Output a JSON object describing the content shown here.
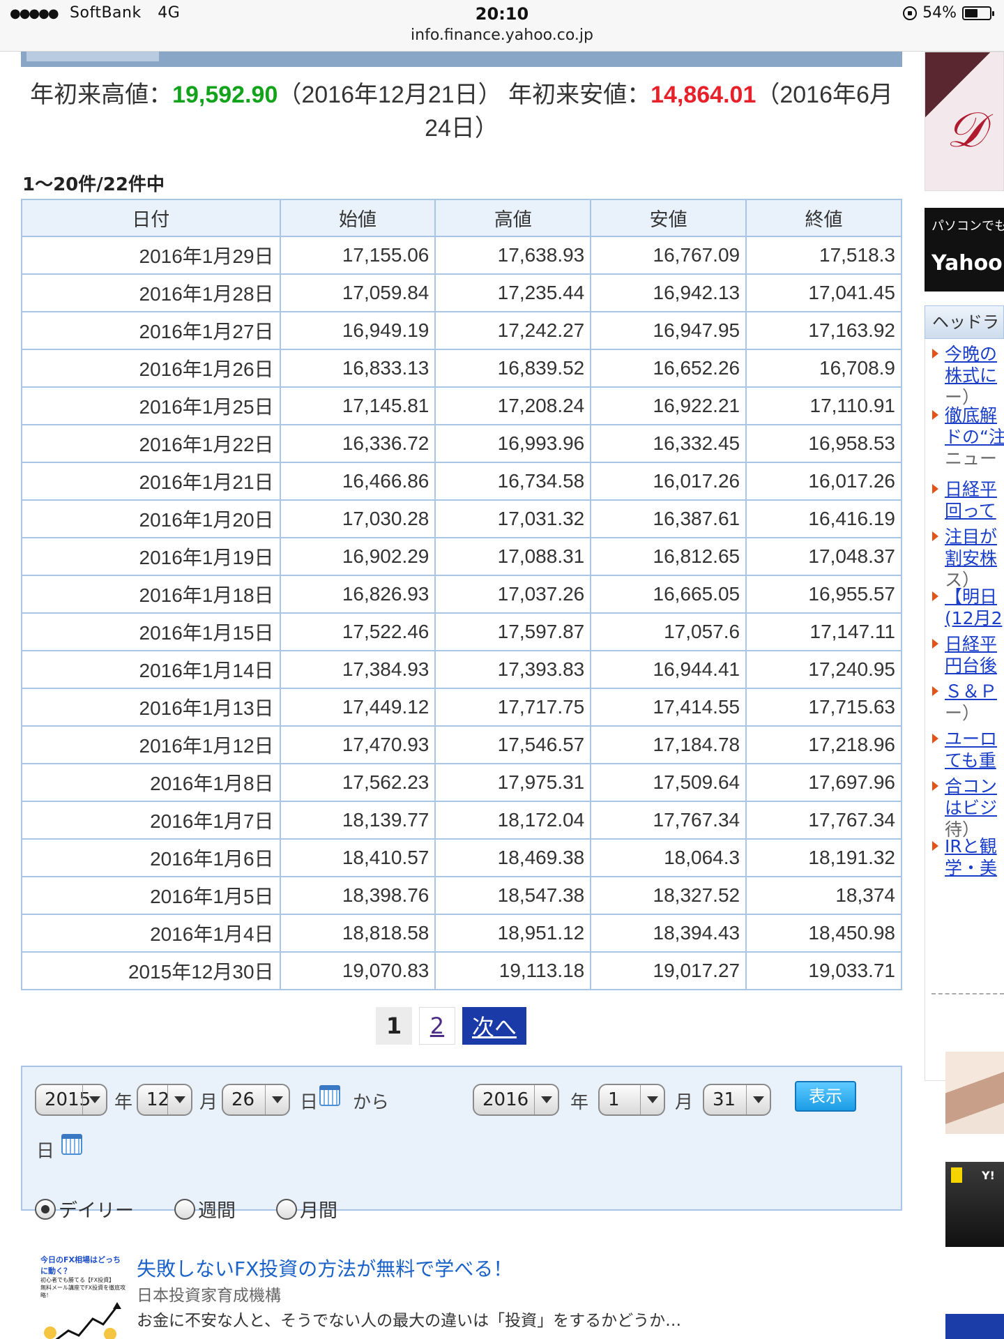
{
  "status_bar": {
    "signal": "●●●●●",
    "carrier": "SoftBank",
    "network": "4G",
    "time": "20:10",
    "battery": "54%"
  },
  "url": "info.finance.yahoo.co.jp",
  "year_range": {
    "high_label": "年初来高値：",
    "high_value": "19,592.90",
    "high_date": "（2016年12月21日）",
    "low_label": "年初来安値：",
    "low_value": "14,864.01",
    "low_date": "（2016年6月24日）"
  },
  "result_count": "1〜20件/22件中",
  "table": {
    "headers": [
      "日付",
      "始値",
      "高値",
      "安値",
      "終値"
    ],
    "rows": [
      [
        "2016年1月29日",
        "17,155.06",
        "17,638.93",
        "16,767.09",
        "17,518.3"
      ],
      [
        "2016年1月28日",
        "17,059.84",
        "17,235.44",
        "16,942.13",
        "17,041.45"
      ],
      [
        "2016年1月27日",
        "16,949.19",
        "17,242.27",
        "16,947.95",
        "17,163.92"
      ],
      [
        "2016年1月26日",
        "16,833.13",
        "16,839.52",
        "16,652.26",
        "16,708.9"
      ],
      [
        "2016年1月25日",
        "17,145.81",
        "17,208.24",
        "16,922.21",
        "17,110.91"
      ],
      [
        "2016年1月22日",
        "16,336.72",
        "16,993.96",
        "16,332.45",
        "16,958.53"
      ],
      [
        "2016年1月21日",
        "16,466.86",
        "16,734.58",
        "16,017.26",
        "16,017.26"
      ],
      [
        "2016年1月20日",
        "17,030.28",
        "17,031.32",
        "16,387.61",
        "16,416.19"
      ],
      [
        "2016年1月19日",
        "16,902.29",
        "17,088.31",
        "16,812.65",
        "17,048.37"
      ],
      [
        "2016年1月18日",
        "16,826.93",
        "17,037.26",
        "16,665.05",
        "16,955.57"
      ],
      [
        "2016年1月15日",
        "17,522.46",
        "17,597.87",
        "17,057.6",
        "17,147.11"
      ],
      [
        "2016年1月14日",
        "17,384.93",
        "17,393.83",
        "16,944.41",
        "17,240.95"
      ],
      [
        "2016年1月13日",
        "17,449.12",
        "17,717.75",
        "17,414.55",
        "17,715.63"
      ],
      [
        "2016年1月12日",
        "17,470.93",
        "17,546.57",
        "17,184.78",
        "17,218.96"
      ],
      [
        "2016年1月8日",
        "17,562.23",
        "17,975.31",
        "17,509.64",
        "17,697.96"
      ],
      [
        "2016年1月7日",
        "18,139.77",
        "18,172.04",
        "17,767.34",
        "17,767.34"
      ],
      [
        "2016年1月6日",
        "18,410.57",
        "18,469.38",
        "18,064.3",
        "18,191.32"
      ],
      [
        "2016年1月5日",
        "18,398.76",
        "18,547.38",
        "18,327.52",
        "18,374"
      ],
      [
        "2016年1月4日",
        "18,818.58",
        "18,951.12",
        "18,394.43",
        "18,450.98"
      ],
      [
        "2015年12月30日",
        "19,070.83",
        "19,113.18",
        "19,017.27",
        "19,033.71"
      ]
    ]
  },
  "pagination": {
    "current": "1",
    "page2": "2",
    "next": "次へ"
  },
  "range_form": {
    "from_year": "2015",
    "from_month": "12",
    "from_day": "26",
    "to_year": "2016",
    "to_month": "1",
    "to_day": "31",
    "year_label": "年",
    "month_label": "月",
    "day_label": "日",
    "from_label": "から",
    "submit": "表示",
    "radios": [
      "デイリー",
      "週間",
      "月間"
    ],
    "selected_radio": "デイリー"
  },
  "ad": {
    "thumb_title": "今日のFX相場はどっちに動く？",
    "thumb_sub1": "初心者でも勝てる【FX投資】",
    "thumb_sub2": "無料メール講座でFX投資を徹底攻略！",
    "headline": "失敗しないFX投資の方法が無料で学べる！",
    "sponsor": "日本投資家育成機構",
    "description": "お金に不安な人と、そうでない人の最大の違いは「投資」をするかどうか…"
  },
  "sidebar": {
    "yahoo_banner_line1": "パソコンでも",
    "yahoo_banner_line2": "Yahoo!",
    "headline_title": "ヘッドラ",
    "news": [
      {
        "l1": "今晩の",
        "l2": "株式に",
        "src": "ー）"
      },
      {
        "l1": "徹底解",
        "l2": "ドの“注",
        "src": "ニュー"
      },
      {
        "l1": "日経平",
        "l2": "回って",
        "src": ""
      },
      {
        "l1": "注目が",
        "l2": "割安株",
        "src": "ス）"
      },
      {
        "l1": "【明日",
        "l2": "(12月2",
        "src": ""
      },
      {
        "l1": "日経平",
        "l2": "円台後",
        "src": ""
      },
      {
        "l1": "Ｓ＆Ｐ",
        "l2": "",
        "src": "ー）"
      },
      {
        "l1": "ユーロ",
        "l2": "ても重",
        "src": ""
      },
      {
        "l1": "合コン",
        "l2": "はビジ",
        "src": "待）"
      },
      {
        "l1": "IRと観",
        "l2": "学・美",
        "src": ""
      }
    ],
    "card_logo": "Y!"
  }
}
